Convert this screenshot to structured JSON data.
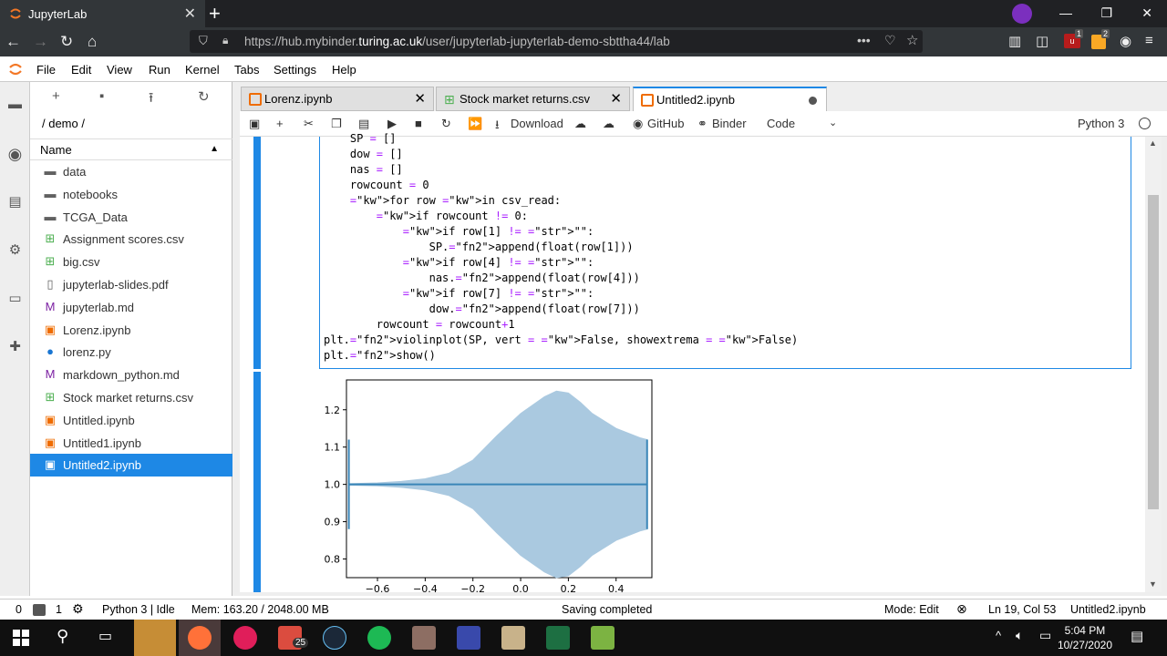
{
  "browser": {
    "tab_title": "JupyterLab",
    "url_prefix": "https://hub.mybinder.",
    "url_domain": "turing.ac.uk",
    "url_rest": "/user/jupyterlab-jupyterlab-demo-sbttha44/lab",
    "badge1": "1",
    "badge2": "2"
  },
  "menu": [
    "File",
    "Edit",
    "View",
    "Run",
    "Kernel",
    "Tabs",
    "Settings",
    "Help"
  ],
  "filebrowser": {
    "breadcrumb": "/ demo /",
    "column_header": "Name",
    "files": [
      {
        "name": "data",
        "icon": "folder-icon",
        "color": "#616161"
      },
      {
        "name": "notebooks",
        "icon": "folder-icon",
        "color": "#616161"
      },
      {
        "name": "TCGA_Data",
        "icon": "folder-icon",
        "color": "#616161"
      },
      {
        "name": "Assignment scores.csv",
        "icon": "spreadsheet-icon",
        "color": "#4caf50"
      },
      {
        "name": "big.csv",
        "icon": "spreadsheet-icon",
        "color": "#4caf50"
      },
      {
        "name": "jupyterlab-slides.pdf",
        "icon": "file-icon",
        "color": "#616161"
      },
      {
        "name": "jupyterlab.md",
        "icon": "markdown-icon",
        "color": "#7b1fa2"
      },
      {
        "name": "Lorenz.ipynb",
        "icon": "notebook-icon",
        "color": "#ef6c00"
      },
      {
        "name": "lorenz.py",
        "icon": "python-icon",
        "color": "#1976d2"
      },
      {
        "name": "markdown_python.md",
        "icon": "markdown-icon",
        "color": "#7b1fa2"
      },
      {
        "name": "Stock market returns.csv",
        "icon": "spreadsheet-icon",
        "color": "#4caf50"
      },
      {
        "name": "Untitled.ipynb",
        "icon": "notebook-icon",
        "color": "#ef6c00"
      },
      {
        "name": "Untitled1.ipynb",
        "icon": "notebook-icon",
        "color": "#ef6c00"
      },
      {
        "name": "Untitled2.ipynb",
        "icon": "notebook-icon",
        "color": "#ffffff",
        "selected": true
      }
    ]
  },
  "tabs": [
    {
      "label": "Lorenz.ipynb"
    },
    {
      "label": "Stock market returns.csv"
    },
    {
      "label": "Untitled2.ipynb"
    }
  ],
  "toolbar": {
    "download": "Download",
    "github": "GitHub",
    "binder": "Binder",
    "cell_type": "Code",
    "kernel": "Python 3"
  },
  "code_lines": [
    "    SP = []",
    "    dow = []",
    "    nas = []",
    "    rowcount = 0",
    "    for row in csv_read:",
    "        if rowcount != 0:",
    "            if row[1] != \"\":",
    "                SP.append(float(row[1]))",
    "            if row[4] != \"\":",
    "                nas.append(float(row[4]))",
    "            if row[7] != \"\":",
    "                dow.append(float(row[7]))",
    "        rowcount = rowcount+1",
    "plt.violinplot(SP, vert = False, showextrema = False)",
    "plt.show()"
  ],
  "chart_data": {
    "type": "violin",
    "orientation": "horizontal",
    "position": 1.0,
    "xticks": [
      "−0.6",
      "−0.4",
      "−0.2",
      "0.0",
      "0.2",
      "0.4"
    ],
    "yticks": [
      "0.8",
      "0.9",
      "1.0",
      "1.1",
      "1.2"
    ],
    "xlim": [
      -0.73,
      0.55
    ],
    "ylim": [
      0.75,
      1.28
    ],
    "data_range": [
      -0.72,
      0.53
    ],
    "density_profile": {
      "x": [
        -0.72,
        -0.6,
        -0.5,
        -0.4,
        -0.3,
        -0.2,
        -0.1,
        0.0,
        0.1,
        0.15,
        0.2,
        0.25,
        0.3,
        0.4,
        0.5,
        0.53
      ],
      "half_width": [
        0.002,
        0.004,
        0.008,
        0.015,
        0.03,
        0.065,
        0.13,
        0.19,
        0.235,
        0.25,
        0.245,
        0.22,
        0.19,
        0.15,
        0.125,
        0.12
      ]
    },
    "fill_color": "#aac9e0",
    "line_color": "#3a86b8"
  },
  "status": {
    "num0": "0",
    "num1": "1",
    "kernel_state": "Python 3 | Idle",
    "memory": "Mem: 163.20 / 2048.00 MB",
    "message": "Saving completed",
    "mode": "Mode: Edit",
    "position": "Ln 19, Col 53",
    "file": "Untitled2.ipynb"
  },
  "taskbar": {
    "time": "5:04 PM",
    "date": "10/27/2020",
    "badge": "25"
  }
}
